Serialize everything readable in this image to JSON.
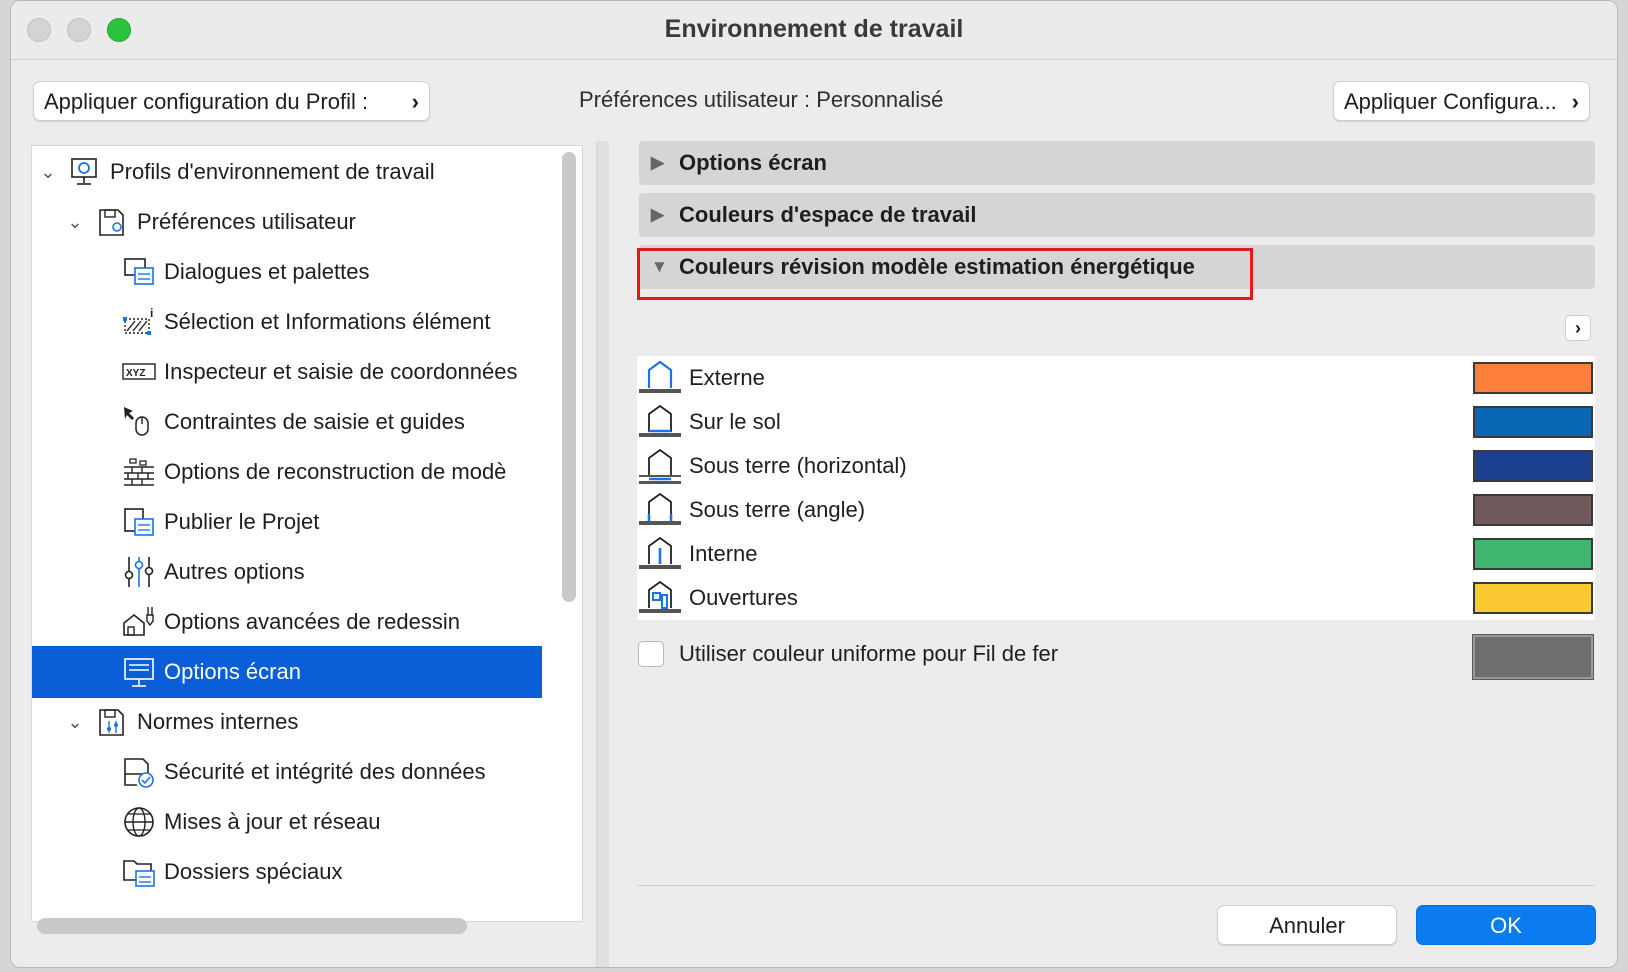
{
  "window": {
    "title": "Environnement de travail"
  },
  "toolbar": {
    "apply_profile_label": "Appliquer configuration du Profil :",
    "user_preferences_text": "Préférences utilisateur : Personnalisé",
    "apply_config_label": "Appliquer Configura..."
  },
  "tree": {
    "items": [
      {
        "label": "Profils d'environnement de travail",
        "icon": "workspace-profiles-icon",
        "expanded": true
      },
      {
        "label": "Préférences utilisateur",
        "icon": "user-preferences-icon",
        "expanded": true
      },
      {
        "label": "Dialogues et palettes",
        "icon": "dialogs-palettes-icon"
      },
      {
        "label": "Sélection et Informations élément",
        "icon": "selection-info-icon"
      },
      {
        "label": "Inspecteur et saisie de coordonnées",
        "icon": "xyz-coordinates-icon"
      },
      {
        "label": "Contraintes de saisie et guides",
        "icon": "input-constraints-icon"
      },
      {
        "label": "Options de reconstruction de modè",
        "icon": "model-rebuild-icon"
      },
      {
        "label": "Publier le Projet",
        "icon": "publish-project-icon"
      },
      {
        "label": "Autres options",
        "icon": "sliders-icon"
      },
      {
        "label": "Options avancées de redessin",
        "icon": "advanced-redraw-icon"
      },
      {
        "label": "Options écran",
        "icon": "screen-options-icon",
        "selected": true
      },
      {
        "label": "Normes internes",
        "icon": "company-standards-icon",
        "expanded": true
      },
      {
        "label": "Sécurité et intégrité des données",
        "icon": "data-safety-icon"
      },
      {
        "label": "Mises à jour et réseau",
        "icon": "globe-icon"
      },
      {
        "label": "Dossiers spéciaux",
        "icon": "special-folders-icon"
      }
    ]
  },
  "sections": [
    {
      "label": "Options écran",
      "expanded": false
    },
    {
      "label": "Couleurs d'espace de travail",
      "expanded": false
    },
    {
      "label": "Couleurs révision modèle estimation énergétique",
      "expanded": true
    }
  ],
  "colors": {
    "items": [
      {
        "label": "Externe",
        "color": "#fe7f3a"
      },
      {
        "label": "Sur le sol",
        "color": "#0a67b5"
      },
      {
        "label": "Sous terre (horizontal)",
        "color": "#1c3f8f"
      },
      {
        "label": "Sous terre (angle)",
        "color": "#725a5c"
      },
      {
        "label": "Interne",
        "color": "#40b570"
      },
      {
        "label": "Ouvertures",
        "color": "#fdc932"
      }
    ],
    "uniform_wireframe_label": "Utiliser couleur uniforme pour Fil de fer",
    "uniform_wireframe_checked": false,
    "uniform_wireframe_color": "#6e6e6e"
  },
  "footer": {
    "cancel_label": "Annuler",
    "ok_label": "OK"
  }
}
